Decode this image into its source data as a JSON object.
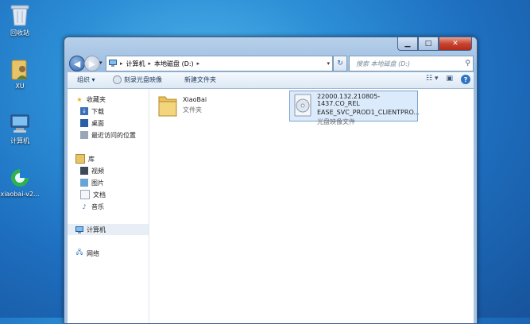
{
  "desktop": {
    "icons": [
      {
        "label": "回收站"
      },
      {
        "label": "XU"
      },
      {
        "label": "计算机"
      },
      {
        "label": "xiaobai-v2..."
      }
    ]
  },
  "window": {
    "address": {
      "part1": "计算机",
      "part2": "本地磁盘 (D:)"
    },
    "search": {
      "placeholder": "搜索 本地磁盘 (D:)"
    },
    "toolbar": {
      "organize": "组织 ▾",
      "burn": "刻录光盘映像",
      "new_folder": "新建文件夹"
    },
    "nav": {
      "favorites": "收藏夹",
      "downloads": "下载",
      "desktop": "桌面",
      "recent": "最近访问的位置",
      "libraries": "库",
      "videos": "视频",
      "pictures": "图片",
      "documents": "文档",
      "music": "音乐",
      "computer": "计算机",
      "network": "网络"
    },
    "files": [
      {
        "name": "XiaoBai",
        "type": "文件夹"
      },
      {
        "name_line1": "22000.132.210805-1437.CO_REL",
        "name_line2": "EASE_SVC_PROD1_CLIENTPRO...",
        "type": "光盘映像文件"
      }
    ]
  },
  "colors": {
    "accent": "#2f74c4",
    "desktop": "#1e6fc0"
  }
}
